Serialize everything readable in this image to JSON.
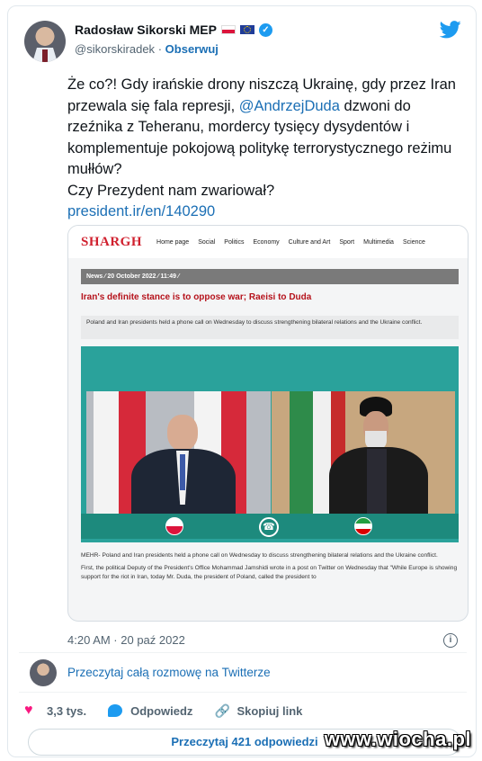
{
  "author": {
    "name": "Radosław Sikorski MEP",
    "handle": "@sikorskiradek",
    "separator": "·",
    "follow_label": "Obserwuj",
    "verified_mark": "✓"
  },
  "tweet": {
    "line1": "Że co?!  Gdy irańskie drony niszczą Ukrainę, gdy przez Iran przewala się fala represji, ",
    "mention": "@AndrzejDuda",
    "line2": " dzwoni do rzeźnika z Teheranu, mordercy tysięcy dysydentów i komplementuje pokojową politykę terrorystycznego reżimu mułłów?",
    "line3": "Czy Prezydent nam zwariował?",
    "link": "president.ir/en/140290"
  },
  "embed": {
    "logo": "SHARGH",
    "nav": [
      "Home page",
      "Social",
      "Politics",
      "Economy",
      "Culture and Art",
      "Sport",
      "Multimedia",
      "Science"
    ],
    "breadcrumb": "News  ⁄  20 October 2022  ⁄  11:49  ⁄",
    "headline": "Iran's definite stance is to oppose war; Raeisi to Duda",
    "lead": "Poland and Iran presidents held a phone call on Wednesday to discuss strengthening bilateral relations and the Ukraine conflict.",
    "body1": "MEHR- Poland and Iran presidents held a phone call on Wednesday to discuss strengthening bilateral relations and the Ukraine conflict.",
    "body2": "First, the political Deputy of the President's Office Mohammad Jamshidi wrote in a post on Twitter on Wednesday that \"While Europe is showing support for the riot in Iran, today Mr. Duda, the president of Poland, called the president to"
  },
  "meta": {
    "time": "4:20 AM · 20 paź 2022",
    "info_icon": "i",
    "read_conversation": "Przeczytaj całą rozmowę na Twitterze"
  },
  "actions": {
    "likes": "3,3 tys.",
    "reply": "Odpowiedz",
    "copy_link": "Skopiuj link",
    "read_replies": "Przeczytaj 421 odpowiedzi"
  },
  "watermark": "www.wiocha.pl",
  "colors": {
    "link": "#1b6fb5",
    "like": "#f91880",
    "twitter_blue": "#1d9bf0",
    "shargh_red": "#d0202e"
  }
}
